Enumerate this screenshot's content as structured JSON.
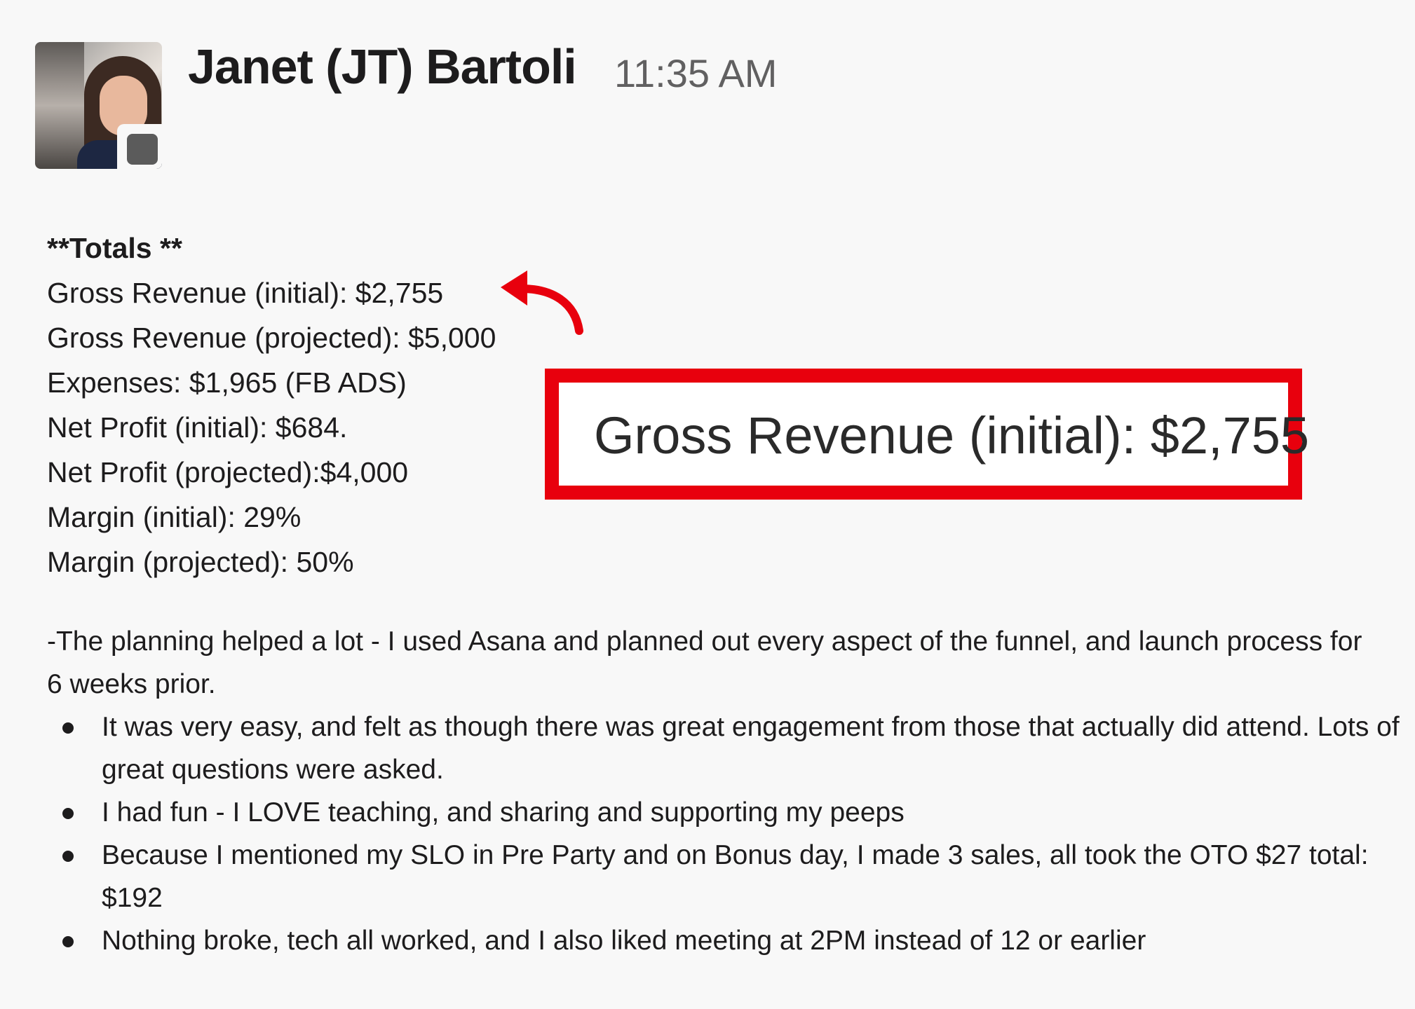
{
  "message": {
    "author": "Janet (JT) Bartoli",
    "time": "11:35 AM",
    "totals": {
      "heading": "**Totals **",
      "lines": [
        "Gross Revenue (initial): $2,755",
        "Gross Revenue (projected): $5,000",
        "Expenses: $1,965 (FB ADS)",
        "Net Profit (initial): $684.",
        "Net Profit (projected):$4,000",
        "Margin (initial): 29%",
        "Margin (projected): 50%"
      ]
    },
    "paragraph": "-The planning helped a lot - I used Asana and planned out every aspect of the funnel, and launch process for 6 weeks prior.",
    "bullets": [
      "It was very easy, and felt as though there was great engagement from those that actually did attend. Lots of great questions were asked.",
      "I had fun - I LOVE teaching, and sharing and supporting my peeps",
      "Because I mentioned my SLO in Pre Party and on Bonus day, I made 3 sales, all took the OTO $27 total: $192",
      "Nothing broke, tech all worked, and I also liked meeting at 2PM instead of 12 or earlier"
    ]
  },
  "callout": {
    "text": "Gross Revenue (initial): $2,755",
    "color": "#e8000d"
  }
}
